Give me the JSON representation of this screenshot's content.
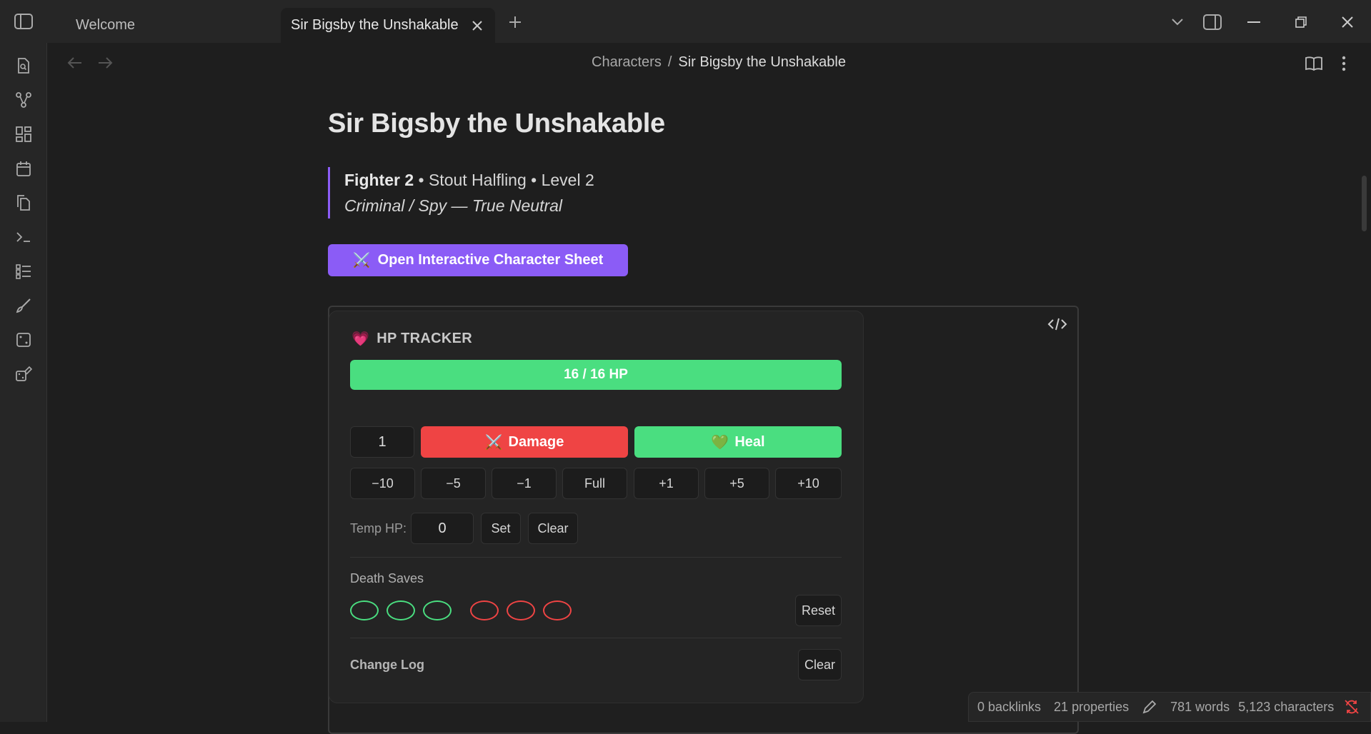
{
  "tabs": [
    {
      "label": "Welcome"
    },
    {
      "label": "Sir Bigsby the Unshakable"
    }
  ],
  "breadcrumb": {
    "parent": "Characters",
    "separator": "/",
    "current": "Sir Bigsby the Unshakable"
  },
  "note": {
    "title": "Sir Bigsby the Unshakable",
    "callout": {
      "class_level": "Fighter 2",
      "rest": " • Stout Halfling • Level 2",
      "line2": "Criminal / Spy — True Neutral"
    },
    "cta_label": "Open Interactive Character Sheet",
    "cta_icon": "⚔️"
  },
  "hp_tracker": {
    "icon": "💗",
    "title": "HP TRACKER",
    "hp_text": "16 / 16 HP",
    "hp_fraction": 1.0,
    "amount_value": "1",
    "damage_label": "Damage",
    "damage_icon": "⚔️",
    "heal_label": "Heal",
    "heal_icon": "💚",
    "quick_buttons": [
      "−10",
      "−5",
      "−1",
      "Full",
      "+1",
      "+5",
      "+10"
    ],
    "temp_hp_label": "Temp HP:",
    "temp_hp_value": "0",
    "set_label": "Set",
    "clear_label": "Clear",
    "death_saves_title": "Death Saves",
    "successes": 3,
    "failures": 3,
    "reset_label": "Reset",
    "change_log_title": "Change Log",
    "change_log_clear_label": "Clear"
  },
  "status_bar": {
    "backlinks": "0 backlinks",
    "properties": "21 properties",
    "words": "781 words",
    "characters": "5,123 characters"
  },
  "colors": {
    "accent": "#8b5cf6",
    "hp_green": "#4ade80",
    "damage_red": "#ef4444"
  }
}
